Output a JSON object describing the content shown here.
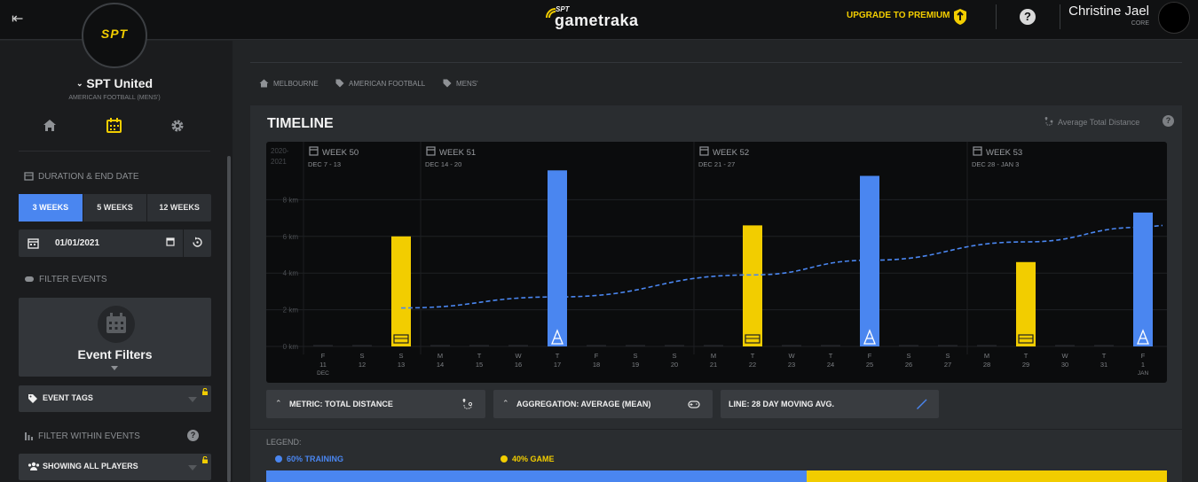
{
  "header": {
    "logo_prefix": "SPT",
    "logo_text": "gametraka",
    "upgrade_label": "UPGRADE TO PREMIUM",
    "user_name": "Christine Jael",
    "user_role": "CORE"
  },
  "sidebar": {
    "badge_text": "SPT",
    "team_name": "SPT United",
    "league": "AMERICAN FOOTBALL (MENS')",
    "duration_title": "DURATION & END DATE",
    "duration_options": [
      "3 WEEKS",
      "5 WEEKS",
      "12 WEEKS"
    ],
    "duration_selected": "3 WEEKS",
    "end_date": "01/01/2021",
    "filter_events_title": "FILTER EVENTS",
    "event_filters_label": "Event Filters",
    "event_tags_label": "EVENT TAGS",
    "filter_within_title": "FILTER WITHIN EVENTS",
    "players_label": "SHOWING ALL PLAYERS"
  },
  "breadcrumbs": [
    "MELBOURNE",
    "AMERICAN FOOTBALL",
    "MENS'"
  ],
  "timeline": {
    "title": "TIMELINE",
    "metric_indicator": "Average Total Distance",
    "controls": {
      "metric": "METRIC: TOTAL DISTANCE",
      "aggregation": "AGGREGATION: AVERAGE (MEAN)",
      "line": "LINE: 28 DAY MOVING AVG."
    },
    "legend_title": "LEGEND:",
    "legend_items": [
      {
        "label": "60% TRAINING",
        "color": "#4a86f0"
      },
      {
        "label": "40% GAME",
        "color": "#f2cd00"
      }
    ]
  },
  "colors": {
    "accent_blue": "#4a86f0",
    "accent_yellow": "#f2cd00",
    "background": "#222426",
    "topbar": "#101112"
  },
  "chart_data": {
    "type": "bar",
    "season_label": [
      "2020-",
      "2021"
    ],
    "y_unit": "km",
    "ylim": [
      0,
      10
    ],
    "y_ticks": [
      "0 km",
      "2 km",
      "4 km",
      "6 km",
      "8 km"
    ],
    "weeks": [
      {
        "label": "WEEK 50",
        "range": "DEC 7 - 13"
      },
      {
        "label": "WEEK 51",
        "range": "DEC 14 - 20"
      },
      {
        "label": "WEEK 52",
        "range": "DEC 21 - 27"
      },
      {
        "label": "WEEK 53",
        "range": "DEC 28 - JAN 3"
      }
    ],
    "days": [
      {
        "dow": "F",
        "date": "11",
        "month": "DEC",
        "value": 0,
        "type": "none"
      },
      {
        "dow": "S",
        "date": "12",
        "value": 0,
        "type": "none"
      },
      {
        "dow": "S",
        "date": "13",
        "value": 6.0,
        "type": "game"
      },
      {
        "dow": "M",
        "date": "14",
        "value": 0,
        "type": "none"
      },
      {
        "dow": "T",
        "date": "15",
        "value": 0,
        "type": "none"
      },
      {
        "dow": "W",
        "date": "16",
        "value": 0,
        "type": "none"
      },
      {
        "dow": "T",
        "date": "17",
        "value": 9.6,
        "type": "training"
      },
      {
        "dow": "F",
        "date": "18",
        "value": 0,
        "type": "none"
      },
      {
        "dow": "S",
        "date": "19",
        "value": 0,
        "type": "none"
      },
      {
        "dow": "S",
        "date": "20",
        "value": 0,
        "type": "none"
      },
      {
        "dow": "M",
        "date": "21",
        "value": 0,
        "type": "none"
      },
      {
        "dow": "T",
        "date": "22",
        "value": 6.6,
        "type": "game"
      },
      {
        "dow": "W",
        "date": "23",
        "value": 0,
        "type": "none"
      },
      {
        "dow": "T",
        "date": "24",
        "value": 0,
        "type": "none"
      },
      {
        "dow": "F",
        "date": "25",
        "value": 9.3,
        "type": "training"
      },
      {
        "dow": "S",
        "date": "26",
        "value": 0,
        "type": "none"
      },
      {
        "dow": "S",
        "date": "27",
        "value": 0,
        "type": "none"
      },
      {
        "dow": "M",
        "date": "28",
        "value": 0,
        "type": "none"
      },
      {
        "dow": "T",
        "date": "29",
        "value": 4.6,
        "type": "game"
      },
      {
        "dow": "W",
        "date": "30",
        "value": 0,
        "type": "none"
      },
      {
        "dow": "T",
        "date": "31",
        "value": 0,
        "type": "none"
      },
      {
        "dow": "F",
        "date": "1",
        "month": "JAN",
        "value": 7.3,
        "type": "training"
      }
    ],
    "moving_avg": [
      {
        "x": "13",
        "y": 2.1
      },
      {
        "x": "17",
        "y": 2.7
      },
      {
        "x": "22",
        "y": 3.9
      },
      {
        "x": "25",
        "y": 4.7
      },
      {
        "x": "29",
        "y": 5.7
      },
      {
        "x": "1",
        "y": 6.5
      }
    ]
  }
}
